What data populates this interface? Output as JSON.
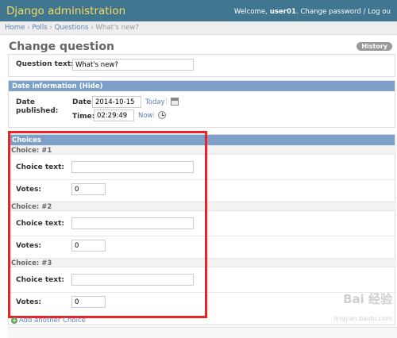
{
  "header": {
    "title": "Django administration",
    "welcome": "Welcome,",
    "username": "user01",
    "links_text": ". Change password / Log ou"
  },
  "breadcrumbs": {
    "home": "Home",
    "sep": "›",
    "polls": "Polls",
    "questions": "Questions",
    "current": "What's new?"
  },
  "page": {
    "title": "Change question",
    "history_label": "History"
  },
  "question": {
    "label": "Question text:",
    "value": "What's new?"
  },
  "date_info": {
    "heading": "Date information",
    "hide_label": "Hide",
    "published_label_1": "Date",
    "published_label_2": "published:",
    "date_label": "Date:",
    "date_value": "2014-10-15",
    "today_link": "Today",
    "time_label": "Time:",
    "time_value": "02:29:49",
    "now_link": "Now"
  },
  "choices": {
    "heading": "Choices",
    "items": [
      {
        "title": "Choice: #1",
        "choice_label": "Choice text:",
        "choice_value": "",
        "votes_label": "Votes:",
        "votes_value": "0"
      },
      {
        "title": "Choice: #2",
        "choice_label": "Choice text:",
        "choice_value": "",
        "votes_label": "Votes:",
        "votes_value": "0"
      },
      {
        "title": "Choice: #3",
        "choice_label": "Choice text:",
        "choice_value": "",
        "votes_label": "Votes:",
        "votes_value": "0"
      }
    ],
    "add_another": "Add another Choice"
  },
  "watermark": {
    "text": "Bai 经验",
    "sub": "jingyan.baidu.com"
  },
  "colors": {
    "header_bg": "#417690",
    "brand_yellow": "#f5dd5d",
    "section_blue": "#7ca0c7",
    "highlight_red": "#e8232a"
  }
}
